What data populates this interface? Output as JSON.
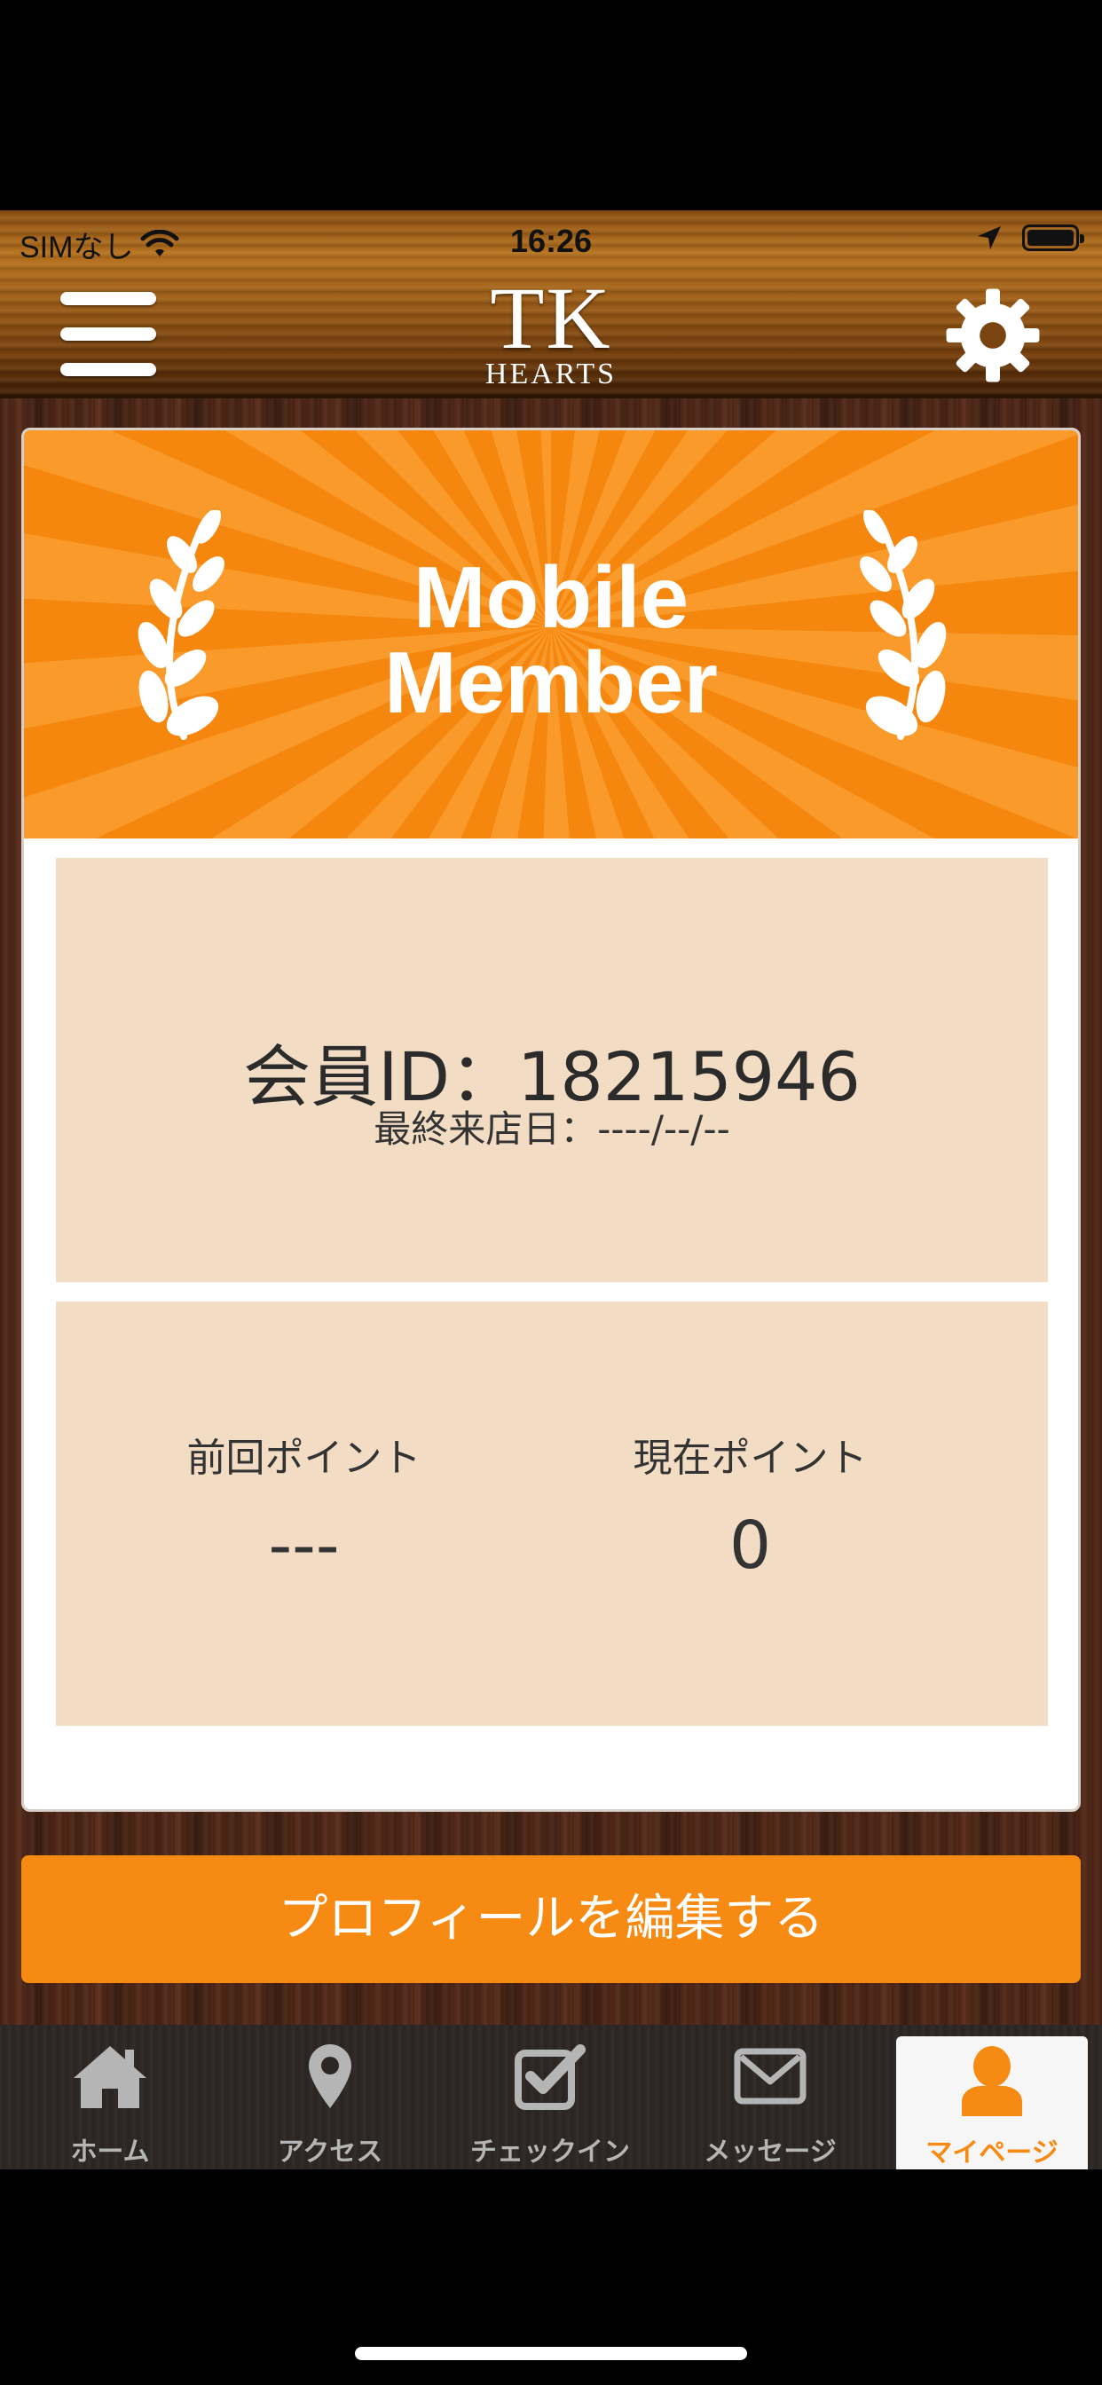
{
  "status_bar": {
    "carrier": "SIMなし",
    "time": "16:26"
  },
  "header": {
    "logo_main": "TK",
    "logo_sub": "HEARTS"
  },
  "card": {
    "banner_line1": "Mobile",
    "banner_line2": "Member",
    "member_id": "会員ID：18215946",
    "last_visit": "最終来店日：----/--/--",
    "previous_points_label": "前回ポイント",
    "previous_points_value": "---",
    "current_points_label": "現在ポイント",
    "current_points_value": "0"
  },
  "edit_profile_label": "プロフィールを編集する",
  "tabs": [
    {
      "label": "ホーム",
      "icon": "home-icon"
    },
    {
      "label": "アクセス",
      "icon": "map-pin-icon"
    },
    {
      "label": "チェックイン",
      "icon": "checkbox-icon"
    },
    {
      "label": "メッセージ",
      "icon": "envelope-icon"
    },
    {
      "label": "マイページ",
      "icon": "user-icon",
      "active": true
    }
  ],
  "colors": {
    "accent": "#f68a12",
    "panel": "#f2dcc3",
    "tabbar": "#2d2724"
  }
}
